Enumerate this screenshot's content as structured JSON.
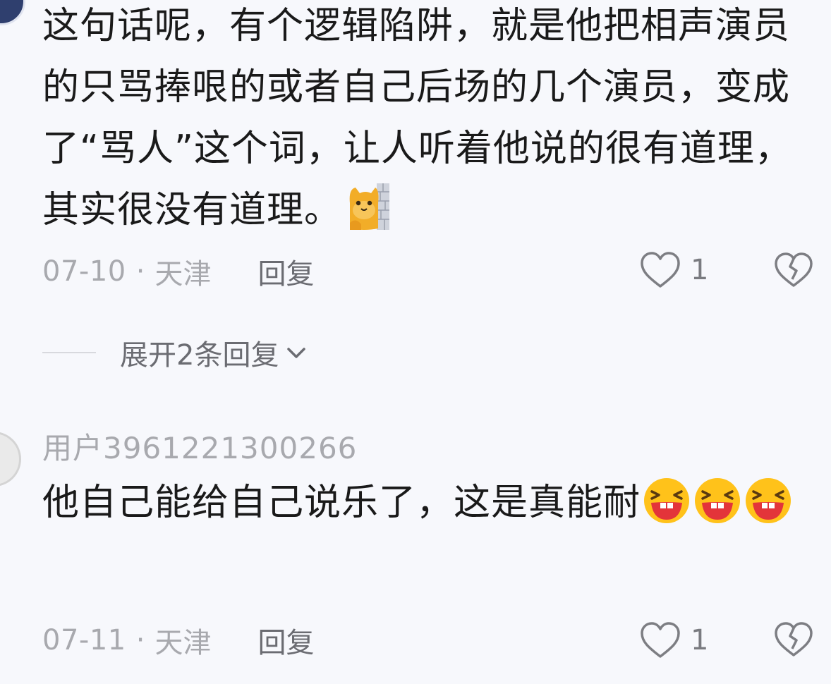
{
  "comments": [
    {
      "text": "这句话呢，有个逻辑陷阱，就是他把相声演员的只骂捧哏的或者自己后场的几个演员，变成了“骂人”这个词，让人听着他说的很有道理，其实很没有道理。",
      "date": "07-10",
      "location": "天津",
      "reply_label": "回复",
      "like_count": "1",
      "expand_label": "展开2条回复"
    },
    {
      "username": "用户3961221300266",
      "text": "他自己能给自己说乐了，这是真能耐",
      "date": "07-11",
      "location": "天津",
      "reply_label": "回复",
      "like_count": "1"
    }
  ],
  "meta_separator": "·",
  "icons": {
    "emoji_1": "wall-peek-cat-emoji",
    "emoji_2": "laughing-face-emoji",
    "like": "heart-outline-icon",
    "dislike": "broken-heart-icon",
    "expand": "chevron-down-icon"
  },
  "colors": {
    "background": "#f7f8fc",
    "text": "#1a1a1a",
    "muted": "#a8a9ae",
    "emoji_yellow": "#ffc21a",
    "emoji_mouth": "#e3343a"
  }
}
